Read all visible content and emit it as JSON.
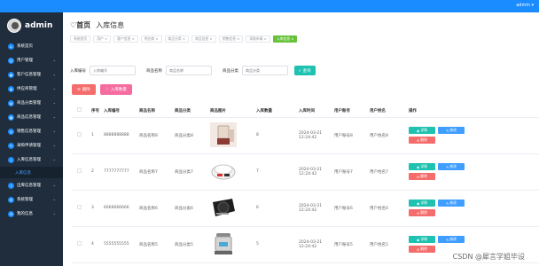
{
  "topbar": {
    "user_label": "admin ▾"
  },
  "sidebar": {
    "brand": "admin",
    "items": [
      {
        "label": "系统首页",
        "icon": "home-icon",
        "has_children": false
      },
      {
        "label": "用户管理",
        "icon": "user-icon",
        "has_children": true
      },
      {
        "label": "客户信息管理",
        "icon": "customer-icon",
        "has_children": true
      },
      {
        "label": "供应商管理",
        "icon": "supplier-icon",
        "has_children": true
      },
      {
        "label": "商品分类管理",
        "icon": "category-icon",
        "has_children": true
      },
      {
        "label": "商品信息管理",
        "icon": "goods-icon",
        "has_children": true
      },
      {
        "label": "销售信息管理",
        "icon": "sales-icon",
        "has_children": true
      },
      {
        "label": "采购申请管理",
        "icon": "purchase-icon",
        "has_children": true
      },
      {
        "label": "入库信息管理",
        "icon": "inbound-icon",
        "has_children": true
      },
      {
        "label": "出库信息管理",
        "icon": "outbound-icon",
        "has_children": true
      },
      {
        "label": "系统管理",
        "icon": "system-icon",
        "has_children": true
      },
      {
        "label": "我的信息",
        "icon": "profile-icon",
        "has_children": true
      }
    ],
    "submenu": {
      "label": "入库信息"
    }
  },
  "breadcrumb": {
    "home": "首页",
    "current": "入库信息"
  },
  "tags": [
    {
      "label": "系统首页",
      "active": false
    },
    {
      "label": "用户 ×",
      "active": false
    },
    {
      "label": "客户信息 ×",
      "active": false
    },
    {
      "label": "供应商 ×",
      "active": false
    },
    {
      "label": "商品分类 ×",
      "active": false
    },
    {
      "label": "商品信息 ×",
      "active": false
    },
    {
      "label": "销售信息 ×",
      "active": false
    },
    {
      "label": "采购申请 ×",
      "active": false
    },
    {
      "label": "入库信息 ×",
      "active": true
    }
  ],
  "search": {
    "f1_label": "入库编号",
    "f1_placeholder": "入库编号",
    "f2_label": "商品名称",
    "f2_placeholder": "商品名称",
    "f3_label": "商品分类",
    "f3_placeholder": "商品分类",
    "button": "查询"
  },
  "actions": {
    "delete": "删除",
    "inbound": "入库数量"
  },
  "table": {
    "headers": [
      "",
      "序号",
      "入库编号",
      "商品名称",
      "商品分类",
      "商品图片",
      "入库数量",
      "入库时间",
      "用户账号",
      "用户姓名",
      "操作"
    ],
    "rows": [
      {
        "index": "1",
        "code": "8888888888",
        "name": "商品名称8",
        "category": "商品分类8",
        "image": "blender-icon",
        "qty": "8",
        "time": "2024-03-21 12:24:42",
        "account": "用户账号8",
        "username": "用户姓名8"
      },
      {
        "index": "2",
        "code": "7777777777",
        "name": "商品名称7",
        "category": "商品分类7",
        "image": "rice-cooker-icon",
        "qty": "7",
        "time": "2024-03-21 12:24:42",
        "account": "用户账号7",
        "username": "用户姓名7"
      },
      {
        "index": "3",
        "code": "6666666666",
        "name": "商品名称6",
        "category": "商品分类6",
        "image": "induction-cooker-icon",
        "qty": "6",
        "time": "2024-03-21 12:24:42",
        "account": "用户账号6",
        "username": "用户姓名6"
      },
      {
        "index": "4",
        "code": "5555555555",
        "name": "商品名称5",
        "category": "商品分类5",
        "image": "steamer-icon",
        "qty": "5",
        "time": "2024-03-21 12:24:42",
        "account": "用户账号5",
        "username": "用户姓名5"
      }
    ],
    "op_detail": "详情",
    "op_edit": "修改",
    "op_delete": "删除"
  },
  "watermark": "CSDN @犀言学姐毕设",
  "colors": {
    "topbar": "#1a8cff",
    "sidebar": "#1f2d3d",
    "accent": "#1fc1b0",
    "danger": "#f56c6c",
    "primary": "#409eff"
  }
}
